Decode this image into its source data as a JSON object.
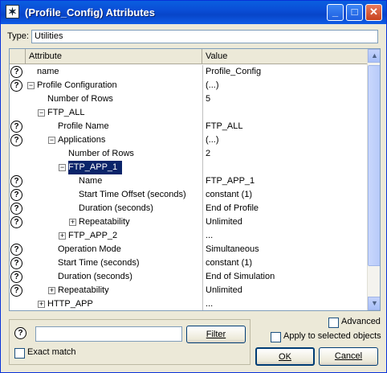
{
  "window": {
    "title": "(Profile_Config) Attributes",
    "minimize": "_",
    "maximize": "□",
    "close": "✕"
  },
  "type_label": "Type:",
  "type_value": "Utilities",
  "grid": {
    "col_attribute": "Attribute",
    "col_value": "Value",
    "rows": [
      {
        "help": true,
        "expander": "",
        "indent": 0,
        "attr": "name",
        "value": "Profile_Config"
      },
      {
        "help": true,
        "expander": "−",
        "indent": 0,
        "attr": "Profile Configuration",
        "value": "(...)"
      },
      {
        "help": false,
        "expander": "",
        "indent": 1,
        "attr": "Number of Rows",
        "value": "5"
      },
      {
        "help": false,
        "expander": "−",
        "indent": 1,
        "attr": "FTP_ALL",
        "value": ""
      },
      {
        "help": true,
        "expander": "",
        "indent": 2,
        "attr": "Profile Name",
        "value": "FTP_ALL"
      },
      {
        "help": true,
        "expander": "−",
        "indent": 2,
        "attr": "Applications",
        "value": "(...)"
      },
      {
        "help": false,
        "expander": "",
        "indent": 3,
        "attr": "Number of Rows",
        "value": "2"
      },
      {
        "help": false,
        "expander": "−",
        "indent": 3,
        "attr": "FTP_APP_1",
        "value": "",
        "selected": true
      },
      {
        "help": true,
        "expander": "",
        "indent": 4,
        "attr": "Name",
        "value": "FTP_APP_1"
      },
      {
        "help": true,
        "expander": "",
        "indent": 4,
        "attr": "Start Time Offset (seconds)",
        "value": "constant (1)"
      },
      {
        "help": true,
        "expander": "",
        "indent": 4,
        "attr": "Duration (seconds)",
        "value": "End of Profile"
      },
      {
        "help": true,
        "expander": "+",
        "indent": 4,
        "attr": "Repeatability",
        "value": "Unlimited"
      },
      {
        "help": false,
        "expander": "+",
        "indent": 3,
        "attr": "FTP_APP_2",
        "value": "..."
      },
      {
        "help": true,
        "expander": "",
        "indent": 2,
        "attr": "Operation Mode",
        "value": "Simultaneous"
      },
      {
        "help": true,
        "expander": "",
        "indent": 2,
        "attr": "Start Time (seconds)",
        "value": "constant (1)"
      },
      {
        "help": true,
        "expander": "",
        "indent": 2,
        "attr": "Duration (seconds)",
        "value": "End of Simulation"
      },
      {
        "help": true,
        "expander": "+",
        "indent": 2,
        "attr": "Repeatability",
        "value": "Unlimited"
      },
      {
        "help": false,
        "expander": "+",
        "indent": 1,
        "attr": "HTTP_APP",
        "value": "..."
      }
    ]
  },
  "filter": {
    "value": "",
    "button_label": "Filter",
    "exact_match_label": "Exact match"
  },
  "options": {
    "advanced_label": "Advanced",
    "apply_selected_label": "Apply to selected objects"
  },
  "buttons": {
    "ok_label": "OK",
    "cancel_label": "Cancel"
  },
  "icons": {
    "help": "?",
    "scroll_up": "▲",
    "scroll_down": "▼"
  }
}
